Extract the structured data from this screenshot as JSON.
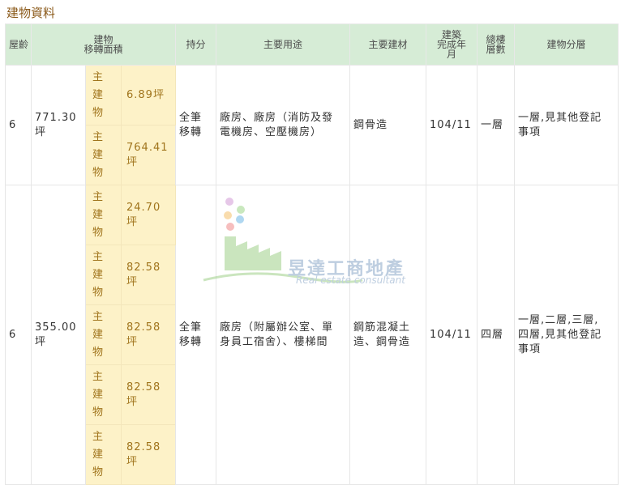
{
  "section": {
    "title": "建物資料"
  },
  "headers": {
    "age": "屋齡",
    "area": "建物\n移轉面積",
    "share": "持分",
    "use": "主要用途",
    "material": "主要建材",
    "built": "建築\n完成年\n月",
    "floors_total": "總樓\n層數",
    "floors": "建物分層"
  },
  "rows": [
    {
      "age": "6",
      "area": "771.30\n坪",
      "subs": [
        {
          "kind": "主\n建\n物",
          "area": "6.89坪"
        },
        {
          "kind": "主\n建\n物",
          "area": "764.41\n坪"
        }
      ],
      "share": "全筆\n移轉",
      "use": "廠房、廠房（消防及發\n電機房、空壓機房）",
      "material": "鋼骨造",
      "built": "104/11",
      "floors_total": "一層",
      "floors": "一層,見其他登記\n事項"
    },
    {
      "age": "6",
      "area": "355.00\n坪",
      "subs": [
        {
          "kind": "主\n建\n物",
          "area": "24.70\n坪"
        },
        {
          "kind": "主\n建\n物",
          "area": "82.58\n坪"
        },
        {
          "kind": "主\n建\n物",
          "area": "82.58\n坪"
        },
        {
          "kind": "主\n建\n物",
          "area": "82.58\n坪"
        },
        {
          "kind": "主\n建\n物",
          "area": "82.58\n坪"
        }
      ],
      "share": "全筆\n移轉",
      "use": "廠房（附屬辦公室、單\n身員工宿舍）、樓梯間",
      "material": "鋼筋混凝土\n造、鋼骨造",
      "built": "104/11",
      "floors_total": "四層",
      "floors": "一層,二層,三層,\n四層,見其他登記\n事項"
    }
  ],
  "watermark": {
    "name": "昱達工商地產",
    "tagline": "Real estate consultant"
  }
}
